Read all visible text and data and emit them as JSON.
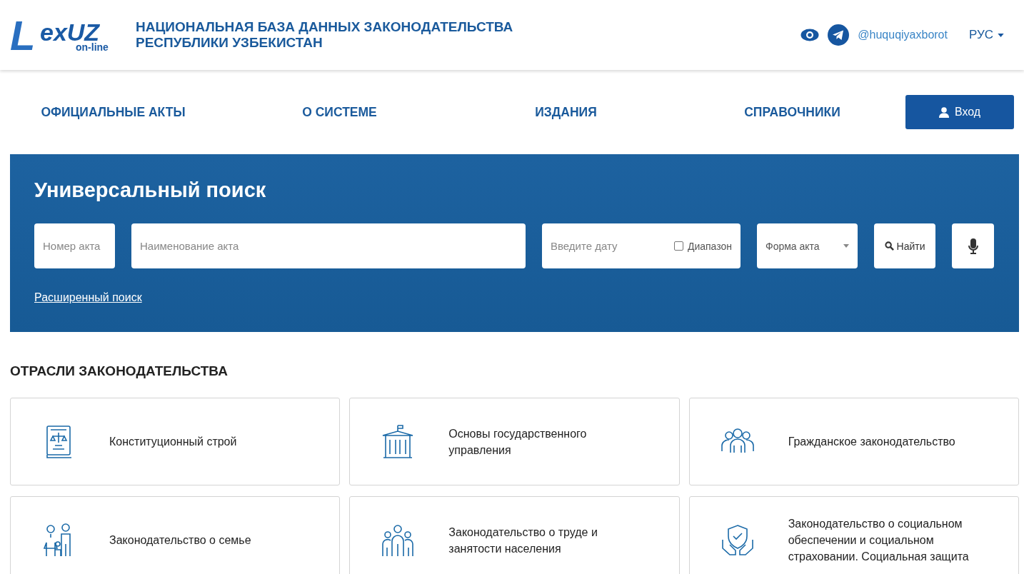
{
  "header": {
    "logo": {
      "mark": "L",
      "word": "exUZ",
      "sub": "on-line"
    },
    "title_lines": [
      "НАЦИОНАЛЬНАЯ БАЗА ДАННЫХ ЗАКОНОДАТЕЛЬСТВА",
      "РЕСПУБЛИКИ УЗБЕКИСТАН"
    ],
    "telegram": "@huquqiyaxborot",
    "language": "РУС"
  },
  "nav": {
    "items": [
      "ОФИЦИАЛЬНЫЕ АКТЫ",
      "О СИСТЕМЕ",
      "ИЗДАНИЯ",
      "СПРАВОЧНИКИ"
    ],
    "login": "Вход"
  },
  "search": {
    "title": "Универсальный поиск",
    "number": {
      "placeholder": "Номер акта"
    },
    "name": {
      "placeholder": "Наименование акта"
    },
    "date": {
      "placeholder": "Введите дату"
    },
    "range": {
      "label": "Диапазон",
      "checked": false
    },
    "form": {
      "placeholder": "Форма акта"
    },
    "find": "Найти",
    "advanced": "Расширенный поиск"
  },
  "branches": {
    "title": "ОТРАСЛИ ЗАКОНОДАТЕЛЬСТВА",
    "cards": [
      {
        "kind": "book",
        "label": "Конституционный строй"
      },
      {
        "kind": "building",
        "label": "Основы государственного управления"
      },
      {
        "kind": "people",
        "label": "Гражданское законодательство"
      },
      {
        "kind": "family",
        "label": "Законодательство о семье"
      },
      {
        "kind": "workers",
        "label": "Законодательство о труде и занятости населения"
      },
      {
        "kind": "shield",
        "label": "Законодательство о социальном обеспечении и социальном страховании. Социальная защита"
      }
    ]
  }
}
